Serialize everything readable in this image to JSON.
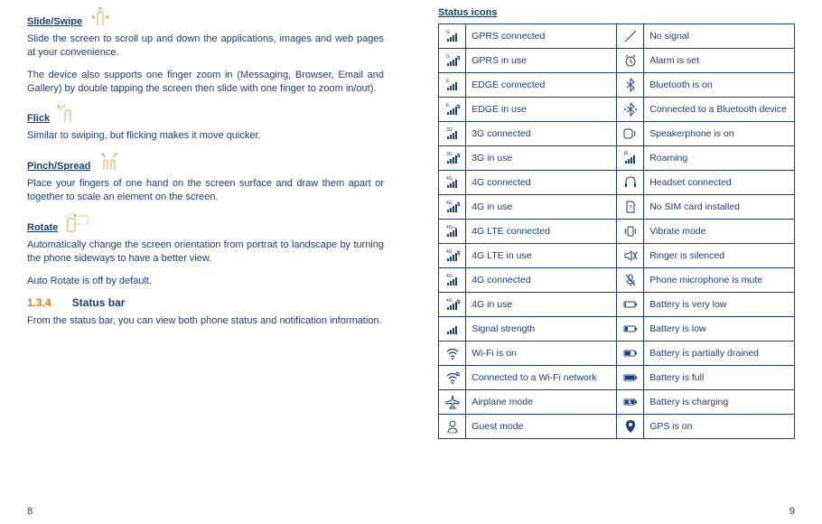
{
  "left": {
    "gestures": {
      "slide": {
        "title": "Slide/Swipe",
        "p1": "Slide the screen to scroll up and down the applications, images and web pages at your convenience.",
        "p2": "The device also supports one finger zoom in (Messaging, Browser, Email and Gallery) by double tapping the screen then slide with one finger to zoom in/out)."
      },
      "flick": {
        "title": "Flick",
        "p1": "Similar to swiping, but flicking makes it move quicker."
      },
      "pinch": {
        "title": "Pinch/Spread",
        "p1": "Place your fingers of one hand on the screen surface and draw them apart or together to scale an element on the screen."
      },
      "rotate": {
        "title": "Rotate",
        "p1": "Automatically change the screen orientation from portrait to landscape by turning the phone sideways to have a better view.",
        "p2": "Auto Rotate is off by default."
      }
    },
    "section": {
      "num": "1.3.4",
      "title": "Status bar",
      "p1": "From the status bar, you can view both phone status and notification information."
    }
  },
  "right": {
    "heading": "Status icons",
    "rows": [
      {
        "l_icon": "gprs-conn",
        "l_label": "GPRS connected",
        "r_icon": "no-signal",
        "r_label": "No signal"
      },
      {
        "l_icon": "gprs-use",
        "l_label": "GPRS in use",
        "r_icon": "alarm",
        "r_label": "Alarm is set"
      },
      {
        "l_icon": "edge-conn",
        "l_label": "EDGE connected",
        "r_icon": "bluetooth",
        "r_label": "Bluetooth is on"
      },
      {
        "l_icon": "edge-use",
        "l_label": "EDGE in use",
        "r_icon": "bluetooth-conn",
        "r_label": "Connected to a Bluetooth device"
      },
      {
        "l_icon": "3g-conn",
        "l_label": "3G connected",
        "r_icon": "speaker",
        "r_label": "Speakerphone is on"
      },
      {
        "l_icon": "3g-use",
        "l_label": "3G in use",
        "r_icon": "roaming",
        "r_label": "Roaming"
      },
      {
        "l_icon": "4g-conn",
        "l_label": "4G connected",
        "r_icon": "headset",
        "r_label": "Headset connected"
      },
      {
        "l_icon": "4g-use",
        "l_label": "4G in use",
        "r_icon": "no-sim",
        "r_label": "No SIM card installed"
      },
      {
        "l_icon": "4glte-conn",
        "l_label": "4G LTE connected",
        "r_icon": "vibrate",
        "r_label": "Vibrate mode"
      },
      {
        "l_icon": "4glte-use",
        "l_label": "4G LTE in use",
        "r_icon": "silent",
        "r_label": "Ringer is silenced"
      },
      {
        "l_icon": "4g-conn2",
        "l_label": "4G connected",
        "r_icon": "mic-mute",
        "r_label": "Phone microphone is mute"
      },
      {
        "l_icon": "4g-use2",
        "l_label": "4G in use",
        "r_icon": "bat-vlow",
        "r_label": "Battery is very low"
      },
      {
        "l_icon": "signal",
        "l_label": "Signal strength",
        "r_icon": "bat-low",
        "r_label": "Battery is low"
      },
      {
        "l_icon": "wifi",
        "l_label": "Wi-Fi is on",
        "r_icon": "bat-part",
        "r_label": "Battery is partially drained"
      },
      {
        "l_icon": "wifi-conn",
        "l_label": "Connected to a Wi-Fi network",
        "r_icon": "bat-full",
        "r_label": "Battery is full"
      },
      {
        "l_icon": "airplane",
        "l_label": "Airplane mode",
        "r_icon": "bat-charge",
        "r_label": "Battery is charging"
      },
      {
        "l_icon": "guest",
        "l_label": "Guest mode",
        "r_icon": "gps",
        "r_label": "GPS is on"
      }
    ]
  },
  "pagenums": {
    "left": "8",
    "right": "9"
  }
}
